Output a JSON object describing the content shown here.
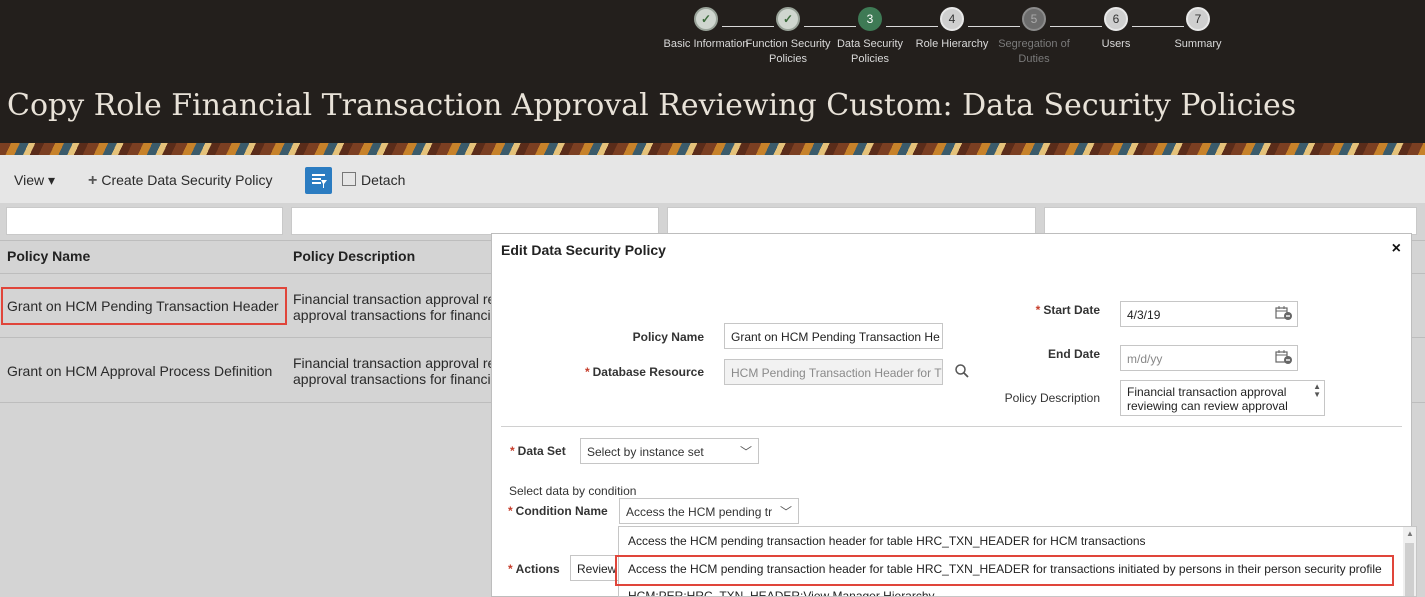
{
  "train": {
    "steps": [
      {
        "num": "✓",
        "label": "Basic Information",
        "state": "done"
      },
      {
        "num": "✓",
        "label": "Function Security Policies",
        "state": "done"
      },
      {
        "num": "3",
        "label": "Data Security Policies",
        "state": "current"
      },
      {
        "num": "4",
        "label": "Role Hierarchy",
        "state": "future"
      },
      {
        "num": "5",
        "label": "Segregation of Duties",
        "state": "disabled"
      },
      {
        "num": "6",
        "label": "Users",
        "state": "future"
      },
      {
        "num": "7",
        "label": "Summary",
        "state": "future"
      }
    ]
  },
  "page": {
    "title": "Copy Role Financial Transaction Approval Reviewing Custom: Data Security Policies"
  },
  "toolbar": {
    "view_label": "View ▾",
    "create_label": "Create Data Security Policy",
    "detach_label": "Detach"
  },
  "table": {
    "headers": [
      "Policy Name",
      "Policy Description"
    ],
    "rows": [
      {
        "name": "Grant on HCM Pending Transaction Header",
        "desc1": "Financial transaction approval re",
        "desc2": "approval transactions for financi"
      },
      {
        "name": "Grant on HCM Approval Process Definition",
        "desc1": "Financial transaction approval re",
        "desc2": "approval transactions for financi"
      }
    ]
  },
  "dialog": {
    "title": "Edit Data Security Policy",
    "close": "×",
    "policy_name_label": "Policy Name",
    "policy_name_value": "Grant on HCM Pending Transaction He",
    "db_resource_label": "Database Resource",
    "db_resource_value": "HCM Pending Transaction Header for T",
    "start_date_label": "Start Date",
    "start_date_value": "4/3/19",
    "end_date_label": "End Date",
    "end_date_placeholder": "m/d/yy",
    "policy_desc_label": "Policy Description",
    "policy_desc_line1": "Financial transaction approval",
    "policy_desc_line2": "reviewing can review approval",
    "data_set_label": "Data Set",
    "data_set_value": "Select by instance set",
    "select_by_condition": "Select data by condition",
    "condition_name_label": "Condition Name",
    "condition_name_value": "Access the HCM pending tr",
    "actions_label": "Actions",
    "actions_value": "Review"
  },
  "condition_options": [
    "Access the HCM pending transaction header for table HRC_TXN_HEADER for HCM transactions",
    "Access the HCM pending transaction header for table HRC_TXN_HEADER for transactions initiated by persons in their person security profile",
    "HCM:PER:HRC_TXN_HEADER:View Manager Hierarchy"
  ],
  "colors": {
    "header_bg": "#231f1c",
    "highlight": "#e0453a",
    "train_current": "#3e7a55",
    "required": "#c63d2b"
  }
}
